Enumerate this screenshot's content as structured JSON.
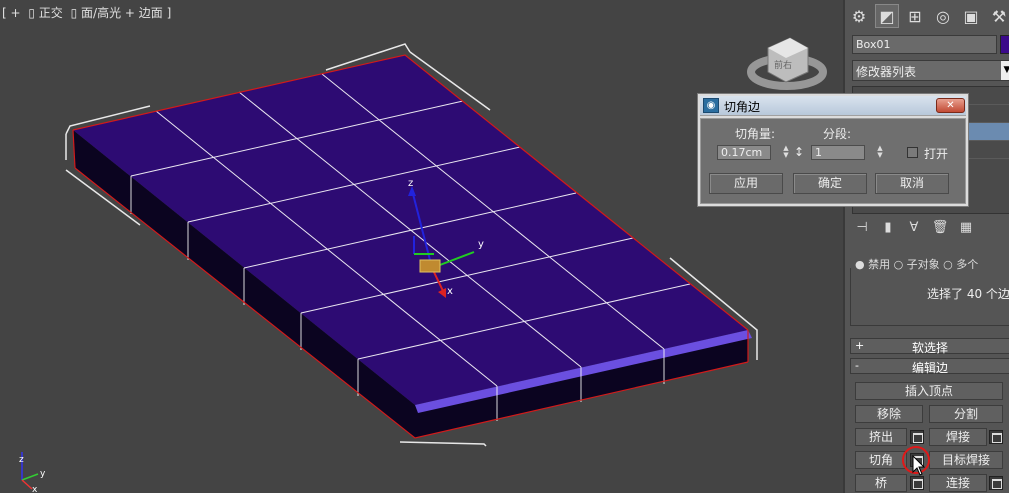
{
  "viewport": {
    "label_parts": [
      "[ +",
      "▯ 正交",
      "▯ 面/高光 + 边面 ]"
    ],
    "gizmo_axes": {
      "x": "x",
      "y": "y",
      "z": "z"
    },
    "corner_axes": {
      "x": "x",
      "y": "y",
      "z": "z"
    },
    "viewcube_face": "前右"
  },
  "panel": {
    "tab_icons": [
      "create-icon",
      "modify-icon",
      "hierarchy-icon",
      "motion-icon",
      "display-icon",
      "utilities-icon"
    ],
    "object_name": "Box01",
    "object_color": "#3b0a8a",
    "modifier_list": "修改器列表",
    "selection_options": "● 禁用 ○ 子对象 ○ 多个",
    "selection_status": "选择了 40 个边",
    "rollouts": {
      "soft_selection": {
        "sign": "+",
        "title": "软选择"
      },
      "edit_edges": {
        "sign": "-",
        "title": "编辑边"
      }
    },
    "buttons": {
      "insert_vertex": "插入顶点",
      "remove": "移除",
      "split": "分割",
      "extrude": "挤出",
      "weld": "焊接",
      "chamfer": "切角",
      "target_weld": "目标焊接",
      "bridge": "桥",
      "connect": "连接"
    }
  },
  "dialog": {
    "title": "切角边",
    "close_glyph": "✕",
    "chamfer_amount_label": "切角量:",
    "chamfer_amount_value": "0.17cm",
    "segments_label": "分段:",
    "segments_value": "1",
    "open_label": "打开",
    "apply": "应用",
    "ok": "确定",
    "cancel": "取消"
  },
  "colors": {
    "viewport_bg": "#444444",
    "top_face": "#2d0b73",
    "side_face": "#0c0420",
    "selected_edge": "#6a4ae0",
    "edge_outline": "#d21a1a"
  }
}
